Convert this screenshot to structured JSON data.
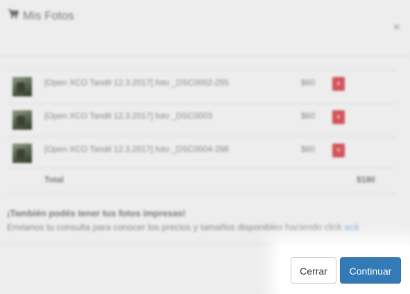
{
  "modal": {
    "title": "Mis Fotos",
    "close_symbol": "×"
  },
  "cart": {
    "items": [
      {
        "name": "[Open XCO Tandil 12.3.2017] foto _DSC0002-255",
        "price": "$60",
        "remove_label": "×"
      },
      {
        "name": "[Open XCO Tandil 12.3.2017] foto _DSC0003",
        "price": "$60",
        "remove_label": "×"
      },
      {
        "name": "[Open XCO Tandil 12.3.2017] foto _DSC0004-266",
        "price": "$60",
        "remove_label": "×"
      }
    ],
    "total_label": "Total",
    "total_value": "$180"
  },
  "print_offer": {
    "heading": "¡También podés tener tus fotos impresas!",
    "text": "Envianos tu consulta para conocer los precios y tamaños disponibles haciendo click ",
    "link_text": "acá"
  },
  "footer": {
    "close_label": "Cerrar",
    "continue_label": "Continuar"
  },
  "colors": {
    "primary": "#337ab7",
    "danger": "#d9534f"
  },
  "icons": {
    "title": "cart-icon",
    "close": "close-icon",
    "remove": "remove-icon",
    "thumbnail": "photo-thumbnail"
  }
}
